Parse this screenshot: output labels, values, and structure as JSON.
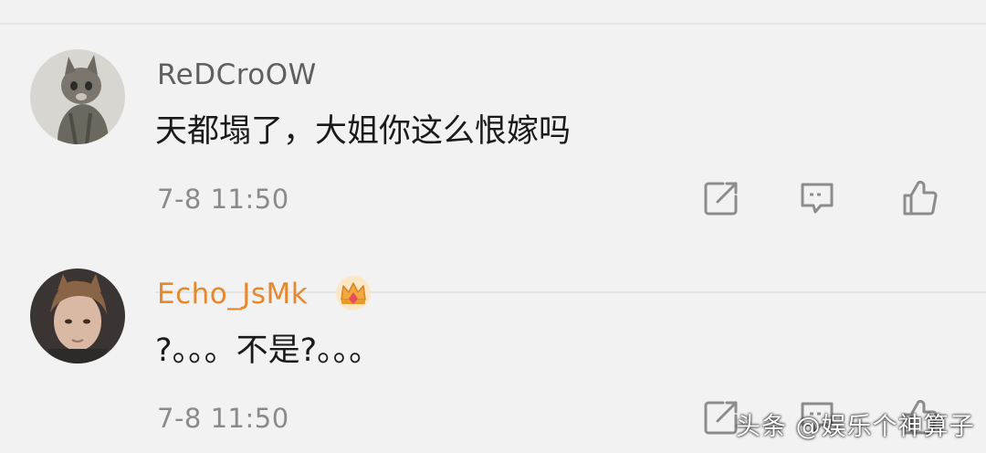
{
  "comments": [
    {
      "username": "ReDCroOW",
      "content": "天都塌了，大姐你这么恨嫁吗",
      "time": "7-8 11:50",
      "avatar_icon": "cat-avatar",
      "vip": false
    },
    {
      "username": "Echo_JsMk",
      "content": "?。。。不是?。。。",
      "time": "7-8 11:50",
      "avatar_icon": "person-avatar",
      "vip": true,
      "badge_icon": "crown-icon"
    }
  ],
  "actions": {
    "share_icon": "share-icon",
    "reply_icon": "comment-icon",
    "like_icon": "thumbs-up-icon"
  },
  "watermark": "头条 @娱乐个神算子",
  "colors": {
    "background": "#f2f2f2",
    "username": "#5f5f5f",
    "vip_username": "#e6882d",
    "content": "#1a1a1a",
    "time": "#8a8a8a",
    "icon": "#8c8c8c"
  }
}
